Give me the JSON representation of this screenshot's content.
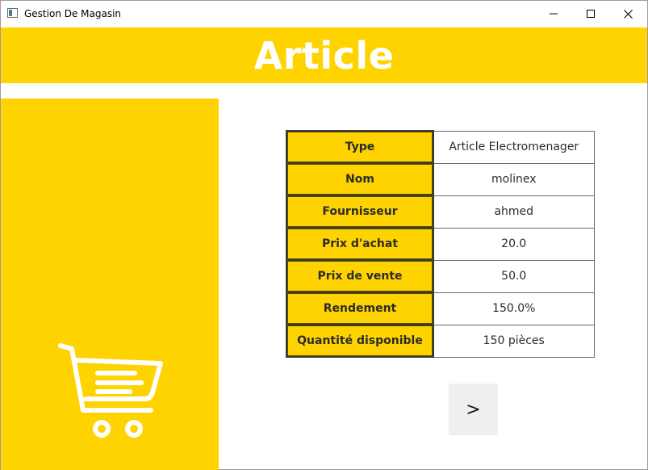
{
  "window": {
    "title": "Gestion De Magasin",
    "controls": [
      "minimize-icon",
      "maximize-icon",
      "close-icon"
    ]
  },
  "header": {
    "title": "Article"
  },
  "side_panel": {
    "icon": "shopping-cart-icon"
  },
  "details": [
    {
      "label": "Type",
      "value": "Article Electromenager"
    },
    {
      "label": "Nom",
      "value": "molinex"
    },
    {
      "label": "Fournisseur",
      "value": "ahmed"
    },
    {
      "label": "Prix d'achat",
      "value": "20.0"
    },
    {
      "label": "Prix de vente",
      "value": "50.0"
    },
    {
      "label": "Rendement",
      "value": "150.0%"
    },
    {
      "label": "Quantité disponible",
      "value": "150 pièces"
    }
  ],
  "actions": {
    "next_label": ">"
  },
  "colors": {
    "accent": "#ffd300",
    "background": "#ffffff",
    "button": "#efefef"
  }
}
